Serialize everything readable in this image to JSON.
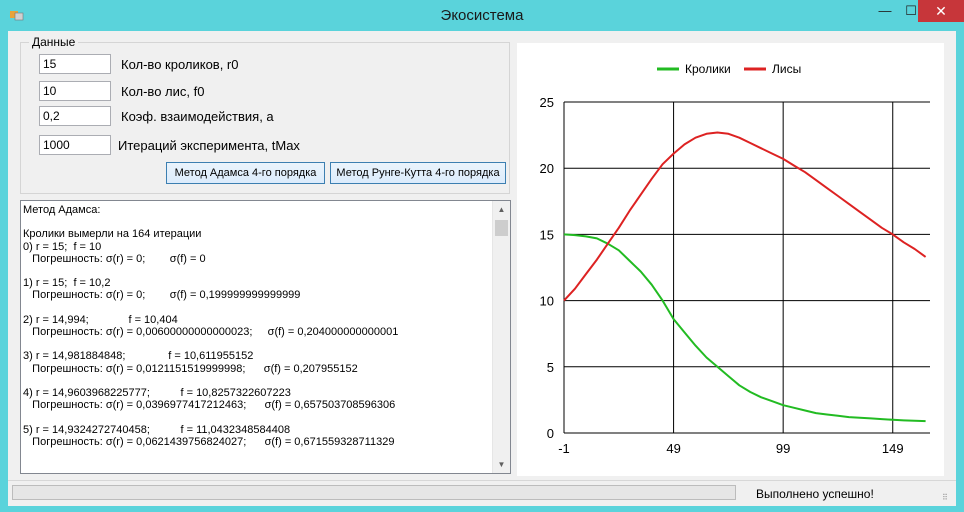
{
  "window": {
    "title": "Экосистема",
    "min_glyph": "—",
    "max_glyph": "☐",
    "close_glyph": "✕"
  },
  "group": {
    "legend": "Данные",
    "fields": [
      {
        "value": "15",
        "label": "Кол-во кроликов, r0"
      },
      {
        "value": "10",
        "label": "Кол-во лис, f0"
      },
      {
        "value": "0,2",
        "label": "Коэф. взаимодействия, a"
      },
      {
        "value": "1000",
        "label": "Итераций эксперимента, tMax"
      }
    ],
    "buttons": {
      "adams": "Метод Адамса 4-го порядка",
      "rk": "Метод Рунге-Кутта 4-го порядка"
    }
  },
  "log": {
    "text": "Метод Адамса:\n\nКролики вымерли на 164 итерации\n0) r = 15;  f = 10\n   Погрешность: σ(r) = 0;        σ(f) = 0\n\n1) r = 15;  f = 10,2\n   Погрешность: σ(r) = 0;        σ(f) = 0,199999999999999\n\n2) r = 14,994;             f = 10,404\n   Погрешность: σ(r) = 0,00600000000000023;     σ(f) = 0,204000000000001\n\n3) r = 14,981884848;              f = 10,611955152\n   Погрешность: σ(r) = 0,0121151519999998;      σ(f) = 0,207955152\n\n4) r = 14,9603968225777;          f = 10,8257322607223\n   Погрешность: σ(r) = 0,0396977417212463;      σ(f) = 0,657503708596306\n\n5) r = 14,9324272740458;          f = 11,0432348584408\n   Погрешность: σ(r) = 0,0621439756824027;      σ(f) = 0,671559328711329"
  },
  "scrollbar": {
    "up_glyph": "▲",
    "down_glyph": "▼"
  },
  "status": {
    "text": "Выполнено успешно!",
    "progress": 0
  },
  "chart_data": {
    "type": "line",
    "title": "",
    "xlabel": "",
    "ylabel": "",
    "xlim": [
      -1,
      166
    ],
    "ylim": [
      0,
      25
    ],
    "x_ticks": [
      -1,
      49,
      99,
      149
    ],
    "y_ticks": [
      0,
      5,
      10,
      15,
      20,
      25
    ],
    "grid": true,
    "legend": "top",
    "series": [
      {
        "name": "Кролики",
        "color": "#22bb22",
        "x": [
          -1,
          4,
          9,
          14,
          19,
          24,
          29,
          34,
          39,
          44,
          49,
          54,
          59,
          64,
          69,
          74,
          79,
          84,
          89,
          94,
          99,
          104,
          109,
          114,
          119,
          124,
          129,
          134,
          139,
          144,
          149,
          154,
          159,
          164
        ],
        "y": [
          15,
          14.95,
          14.85,
          14.7,
          14.3,
          13.8,
          13.0,
          12.2,
          11.2,
          10.0,
          8.6,
          7.6,
          6.6,
          5.7,
          5.0,
          4.3,
          3.6,
          3.1,
          2.7,
          2.4,
          2.1,
          1.9,
          1.7,
          1.5,
          1.4,
          1.3,
          1.2,
          1.15,
          1.1,
          1.05,
          1.0,
          0.95,
          0.92,
          0.9
        ]
      },
      {
        "name": "Лисы",
        "color": "#dd2222",
        "x": [
          -1,
          4,
          9,
          14,
          19,
          24,
          29,
          34,
          39,
          44,
          49,
          54,
          59,
          64,
          69,
          74,
          79,
          84,
          89,
          94,
          99,
          104,
          109,
          114,
          119,
          124,
          129,
          134,
          139,
          144,
          149,
          154,
          159,
          164
        ],
        "y": [
          10,
          10.9,
          12.0,
          13.1,
          14.3,
          15.5,
          16.8,
          18.0,
          19.2,
          20.3,
          21.1,
          21.8,
          22.3,
          22.6,
          22.7,
          22.6,
          22.3,
          21.9,
          21.5,
          21.1,
          20.7,
          20.2,
          19.7,
          19.1,
          18.5,
          17.9,
          17.3,
          16.7,
          16.1,
          15.5,
          15.0,
          14.4,
          13.9,
          13.3
        ]
      }
    ]
  }
}
